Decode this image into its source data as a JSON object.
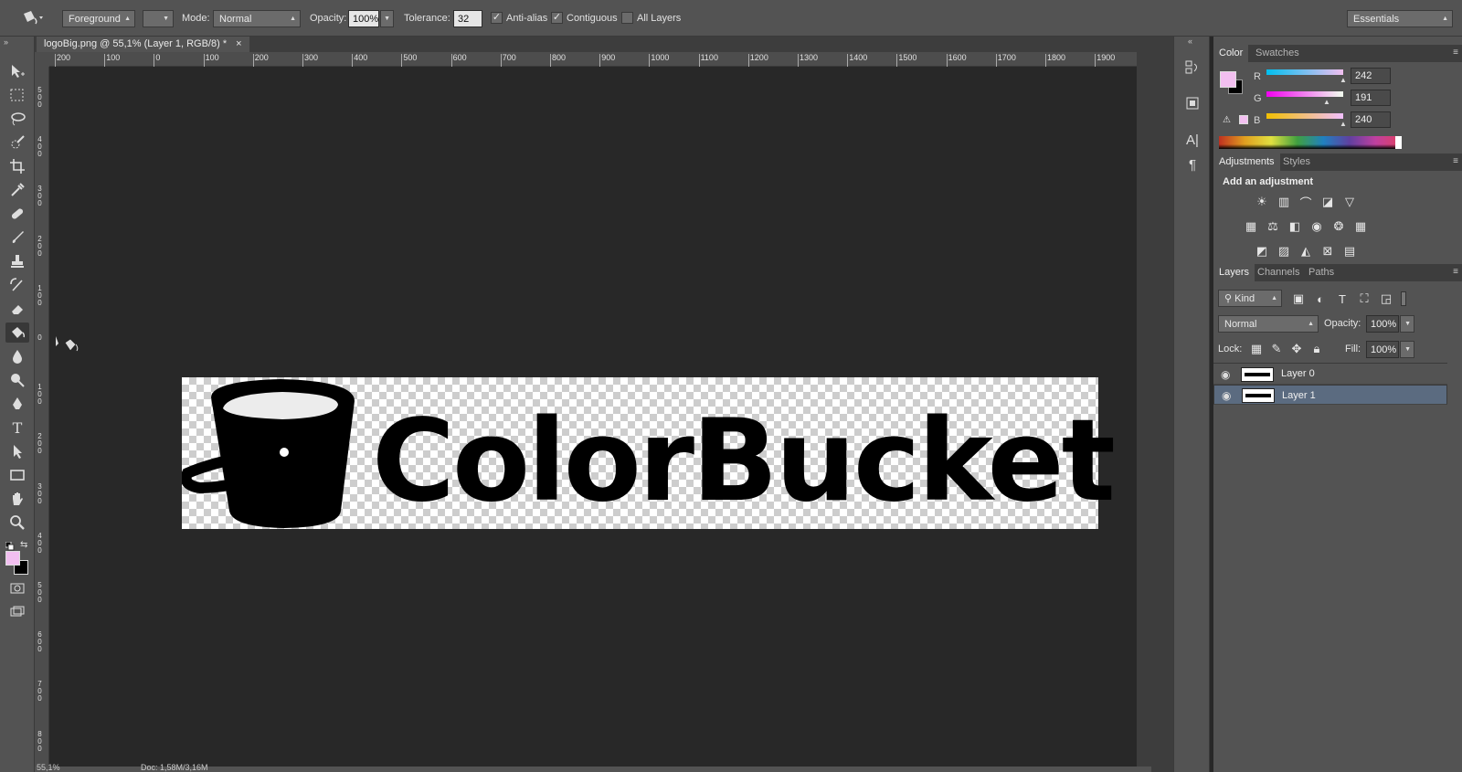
{
  "options_bar": {
    "fill_source": "Foreground",
    "mode_label": "Mode:",
    "mode_value": "Normal",
    "opacity_label": "Opacity:",
    "opacity_value": "100%",
    "tolerance_label": "Tolerance:",
    "tolerance_value": "32",
    "anti_alias_label": "Anti-alias",
    "anti_alias_checked": true,
    "contiguous_label": "Contiguous",
    "contiguous_checked": true,
    "all_layers_label": "All Layers",
    "all_layers_checked": false,
    "workspace": "Essentials"
  },
  "document": {
    "tab_title": "logoBig.png @ 55,1% (Layer 1, RGB/8) *",
    "close_glyph": "×",
    "canvas_text": "ColorBucket",
    "h_ruler_labels": [
      "200",
      "100",
      "0",
      "100",
      "200",
      "300",
      "400",
      "500",
      "600",
      "700",
      "800",
      "900",
      "1000",
      "1100",
      "1200",
      "1300",
      "1400",
      "1500",
      "1600",
      "1700",
      "1800",
      "1900"
    ],
    "v_ruler_labels": [
      "500",
      "400",
      "300",
      "200",
      "100",
      "0",
      "100",
      "200",
      "300",
      "400",
      "500",
      "600",
      "700",
      "800"
    ],
    "status_zoom": "55,1%",
    "status_doc": "Doc: 1,58M/3,16M"
  },
  "color_panel": {
    "tabs": [
      "Color",
      "Swatches"
    ],
    "active_tab": "Color",
    "foreground": "#f2bff0",
    "background": "#000000",
    "channels": [
      {
        "name": "R",
        "value": "242"
      },
      {
        "name": "G",
        "value": "191"
      },
      {
        "name": "B",
        "value": "240"
      }
    ]
  },
  "adjustments_panel": {
    "tabs": [
      "Adjustments",
      "Styles"
    ],
    "active_tab": "Adjustments",
    "heading": "Add an adjustment",
    "icons": [
      "brightness-icon",
      "levels-icon",
      "curves-icon",
      "exposure-icon",
      "vibrance-icon",
      "hue-saturation-icon",
      "color-balance-icon",
      "black-white-icon",
      "photo-filter-icon",
      "channel-mixer-icon",
      "color-lookup-icon",
      "invert-icon",
      "posterize-icon",
      "threshold-icon",
      "selective-color-icon",
      "gradient-map-icon"
    ]
  },
  "layers_panel": {
    "tabs": [
      "Layers",
      "Channels",
      "Paths"
    ],
    "active_tab": "Layers",
    "filter_kind": "Kind",
    "blend_mode": "Normal",
    "opacity_label": "Opacity:",
    "opacity_value": "100%",
    "lock_label": "Lock:",
    "fill_label": "Fill:",
    "fill_value": "100%",
    "layers": [
      {
        "name": "Layer 0",
        "visible": true,
        "selected": false
      },
      {
        "name": "Layer 1",
        "visible": true,
        "selected": true
      }
    ]
  },
  "colors": {
    "ui_bg": "#535353",
    "canvas_bg": "#282828",
    "selection": "#5b6b80"
  }
}
